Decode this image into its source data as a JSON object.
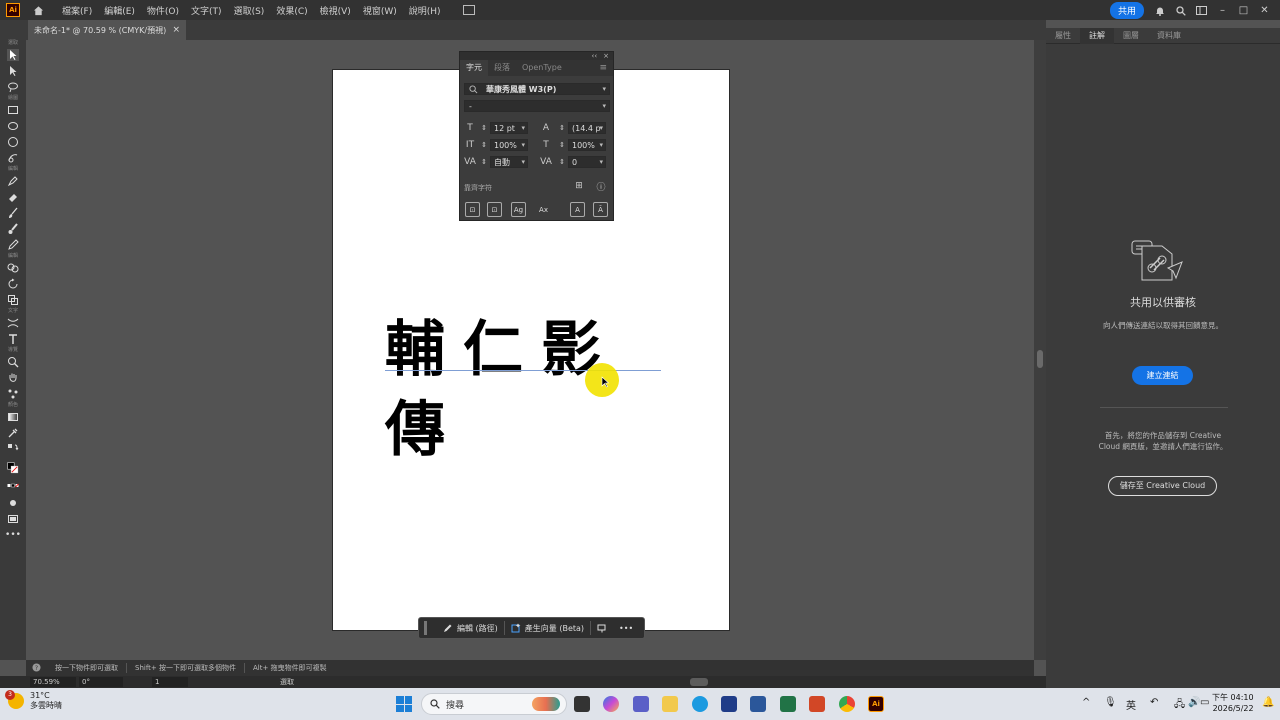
{
  "app": {
    "logo": "Ai",
    "share_label": "共用"
  },
  "menu": [
    "檔案(F)",
    "編輯(E)",
    "物件(O)",
    "文字(T)",
    "選取(S)",
    "效果(C)",
    "檢視(V)",
    "視窗(W)",
    "說明(H)"
  ],
  "document_tab": {
    "title": "未命名-1* @ 70.59 % (CMYK/預視)",
    "close": "×"
  },
  "toolbar": {
    "groups": [
      "選取",
      "繪圖",
      "編輯",
      "文字",
      "導覽",
      "顏色"
    ]
  },
  "artwork": {
    "text": "輔仁影傳"
  },
  "character_panel": {
    "header_icons": [
      "‹‹",
      "×"
    ],
    "tabs": [
      "字元",
      "段落",
      "OpenType"
    ],
    "menu": "≡",
    "font_family": "華康秀風體 W3(P)",
    "font_style": "-",
    "font_size": "12 pt",
    "leading": "(14.4 p",
    "vertical_scale": "100%",
    "horizontal_scale": "100%",
    "kerning": "自動",
    "tracking": "0",
    "snap_label": "靠齊字符",
    "buttons": [
      "⊡",
      "⊡",
      "Ag",
      "Ax",
      "A",
      "Ā"
    ]
  },
  "context_bar": {
    "edit_label": "編輯 (路徑)",
    "generate_label": "產生向量 (Beta)",
    "more": "•••"
  },
  "right_panel": {
    "tabs": [
      "屬性",
      "註解",
      "圖層",
      "資料庫"
    ],
    "title": "共用以供審核",
    "description": "向人們傳送連結以取得其回饋意見。",
    "create_link_label": "建立連結",
    "save_description": "首先，將您的作品儲存到 Creative Cloud 網頁版，並邀請人們進行協作。",
    "save_button_label": "儲存至 Creative Cloud"
  },
  "hints": [
    "按一下物件即可選取",
    "Shift+ 按一下即可選取多個物件",
    "Alt+ 拖曳物件即可複製"
  ],
  "status": {
    "zoom": "70.59%",
    "rotation": "0°",
    "artboard": "1",
    "mode": "選取"
  },
  "taskbar": {
    "weather_temp": "31°C",
    "weather_desc": "多雲時晴",
    "weather_badge": "3",
    "search_placeholder": "搜尋",
    "ai_label": "Ai",
    "ime": "英",
    "time": "下午 04:10",
    "date": "2026/5/22"
  }
}
